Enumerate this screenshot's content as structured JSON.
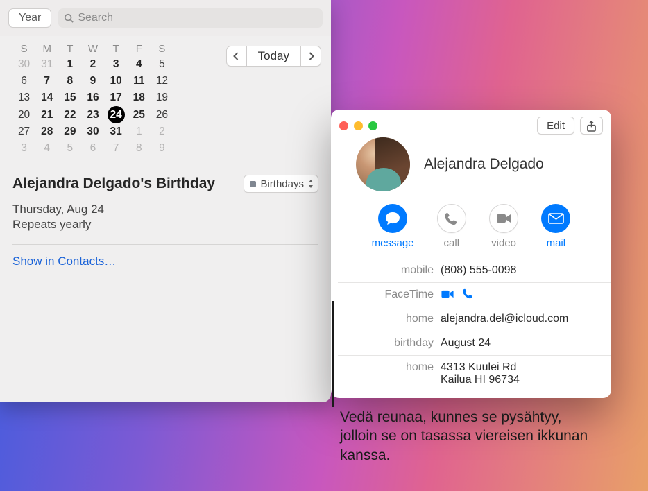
{
  "calendar": {
    "view_label": "Year",
    "search_placeholder": "Search",
    "today_label": "Today",
    "weekdays": [
      "S",
      "M",
      "T",
      "W",
      "T",
      "F",
      "S"
    ],
    "grid": [
      [
        {
          "d": "30",
          "cls": "out"
        },
        {
          "d": "31",
          "cls": "out"
        },
        {
          "d": "1",
          "cls": "bold"
        },
        {
          "d": "2",
          "cls": "bold"
        },
        {
          "d": "3",
          "cls": "bold"
        },
        {
          "d": "4",
          "cls": "bold"
        },
        {
          "d": "5",
          "cls": ""
        }
      ],
      [
        {
          "d": "6",
          "cls": ""
        },
        {
          "d": "7",
          "cls": "bold"
        },
        {
          "d": "8",
          "cls": "bold"
        },
        {
          "d": "9",
          "cls": "bold"
        },
        {
          "d": "10",
          "cls": "bold"
        },
        {
          "d": "11",
          "cls": "bold"
        },
        {
          "d": "12",
          "cls": ""
        }
      ],
      [
        {
          "d": "13",
          "cls": ""
        },
        {
          "d": "14",
          "cls": "bold"
        },
        {
          "d": "15",
          "cls": "bold"
        },
        {
          "d": "16",
          "cls": "bold"
        },
        {
          "d": "17",
          "cls": "bold"
        },
        {
          "d": "18",
          "cls": "bold"
        },
        {
          "d": "19",
          "cls": ""
        }
      ],
      [
        {
          "d": "20",
          "cls": ""
        },
        {
          "d": "21",
          "cls": "bold"
        },
        {
          "d": "22",
          "cls": "bold"
        },
        {
          "d": "23",
          "cls": "bold"
        },
        {
          "d": "24",
          "cls": "sel"
        },
        {
          "d": "25",
          "cls": "bold"
        },
        {
          "d": "26",
          "cls": ""
        }
      ],
      [
        {
          "d": "27",
          "cls": ""
        },
        {
          "d": "28",
          "cls": "bold"
        },
        {
          "d": "29",
          "cls": "bold"
        },
        {
          "d": "30",
          "cls": "bold"
        },
        {
          "d": "31",
          "cls": "bold"
        },
        {
          "d": "1",
          "cls": "out"
        },
        {
          "d": "2",
          "cls": "out"
        }
      ],
      [
        {
          "d": "3",
          "cls": "out"
        },
        {
          "d": "4",
          "cls": "out"
        },
        {
          "d": "5",
          "cls": "out"
        },
        {
          "d": "6",
          "cls": "out"
        },
        {
          "d": "7",
          "cls": "out"
        },
        {
          "d": "8",
          "cls": "out"
        },
        {
          "d": "9",
          "cls": "out"
        }
      ]
    ],
    "event": {
      "title": "Alejandra Delgado's Birthday",
      "category": "Birthdays",
      "date_line": "Thursday, Aug 24",
      "repeat_line": "Repeats yearly",
      "link": "Show in Contacts…"
    }
  },
  "contact": {
    "edit_label": "Edit",
    "name": "Alejandra Delgado",
    "actions": {
      "message": "message",
      "call": "call",
      "video": "video",
      "mail": "mail"
    },
    "fields": {
      "mobile_label": "mobile",
      "mobile_value": "(808) 555-0098",
      "facetime_label": "FaceTime",
      "home_email_label": "home",
      "home_email_value": "alejandra.del@icloud.com",
      "birthday_label": "birthday",
      "birthday_value": "August 24",
      "home_addr_label": "home",
      "home_addr_line1": "4313 Kuulei Rd",
      "home_addr_line2": "Kailua HI 96734"
    }
  },
  "callout": {
    "text": "Vedä reunaa, kunnes se pysähtyy, jolloin se on tasassa viereisen ikkunan kanssa."
  }
}
